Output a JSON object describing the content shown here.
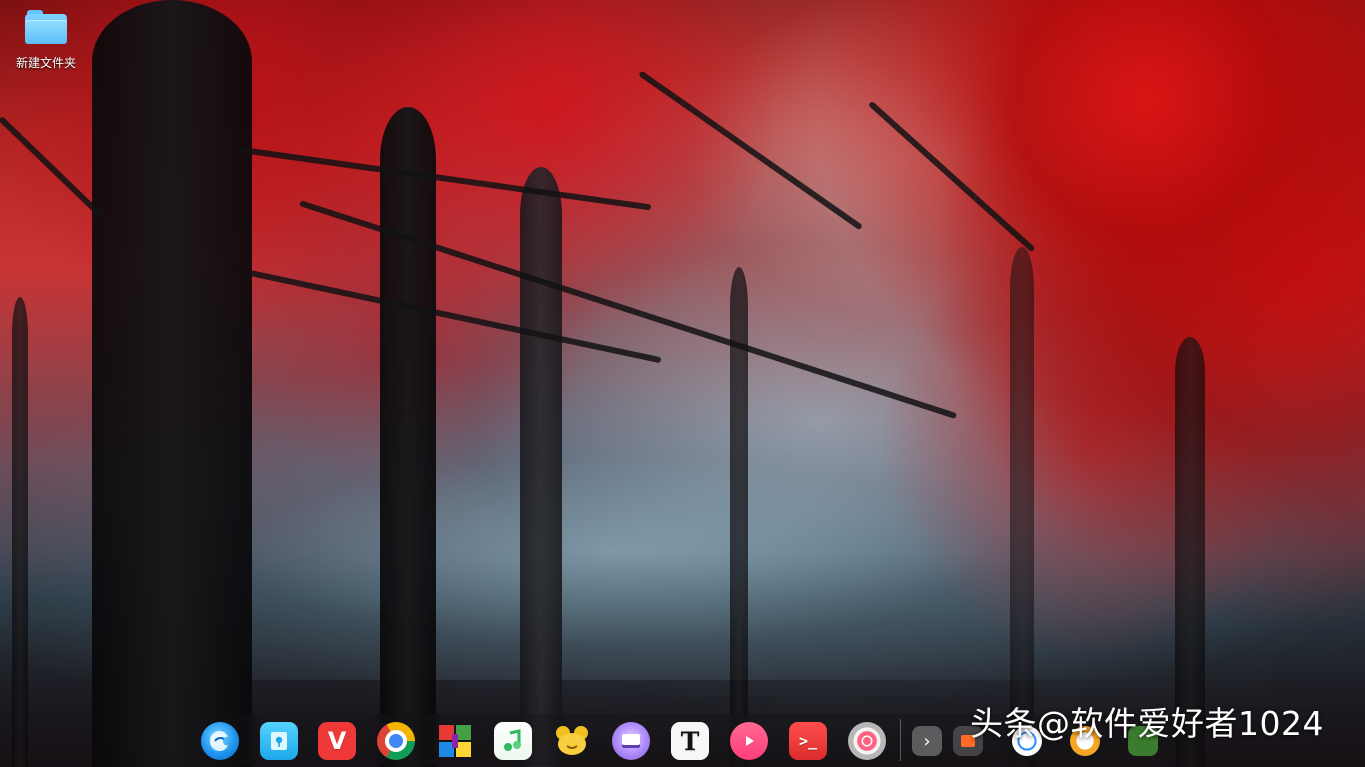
{
  "desktop": {
    "icons": [
      {
        "label": "新建文件夹",
        "icon": "folder-icon"
      }
    ]
  },
  "dock": {
    "apps": [
      {
        "name": "deepin-launcher-icon",
        "color": "#1a8fe6"
      },
      {
        "name": "file-manager-icon",
        "color": "#2ab7ef"
      },
      {
        "name": "vivaldi-browser-icon",
        "color": "#ef3939"
      },
      {
        "name": "chrome-browser-icon",
        "color": "#ffffff"
      },
      {
        "name": "app-store-icon",
        "color": "#ffffff"
      },
      {
        "name": "music-icon",
        "color": "#4ecb72"
      },
      {
        "name": "mascot-app-icon",
        "color": "#f4c431"
      },
      {
        "name": "disk-utility-icon",
        "color": "#a882e6"
      },
      {
        "name": "text-editor-icon",
        "color": "#f7f7f7",
        "text": "T"
      },
      {
        "name": "video-player-icon",
        "color": "#ff4f86"
      },
      {
        "name": "terminal-icon",
        "color": "#e53b3b",
        "text": ">_"
      },
      {
        "name": "settings-icon",
        "color": "#ff5a78"
      }
    ],
    "tray": [
      {
        "name": "chevron-right-icon"
      },
      {
        "name": "input-method-icon"
      },
      {
        "name": "network-icon"
      },
      {
        "name": "volume-icon"
      },
      {
        "name": "battery-icon"
      },
      {
        "name": "trash-icon"
      }
    ]
  },
  "watermark": {
    "text": "头条@软件爱好者1024"
  }
}
